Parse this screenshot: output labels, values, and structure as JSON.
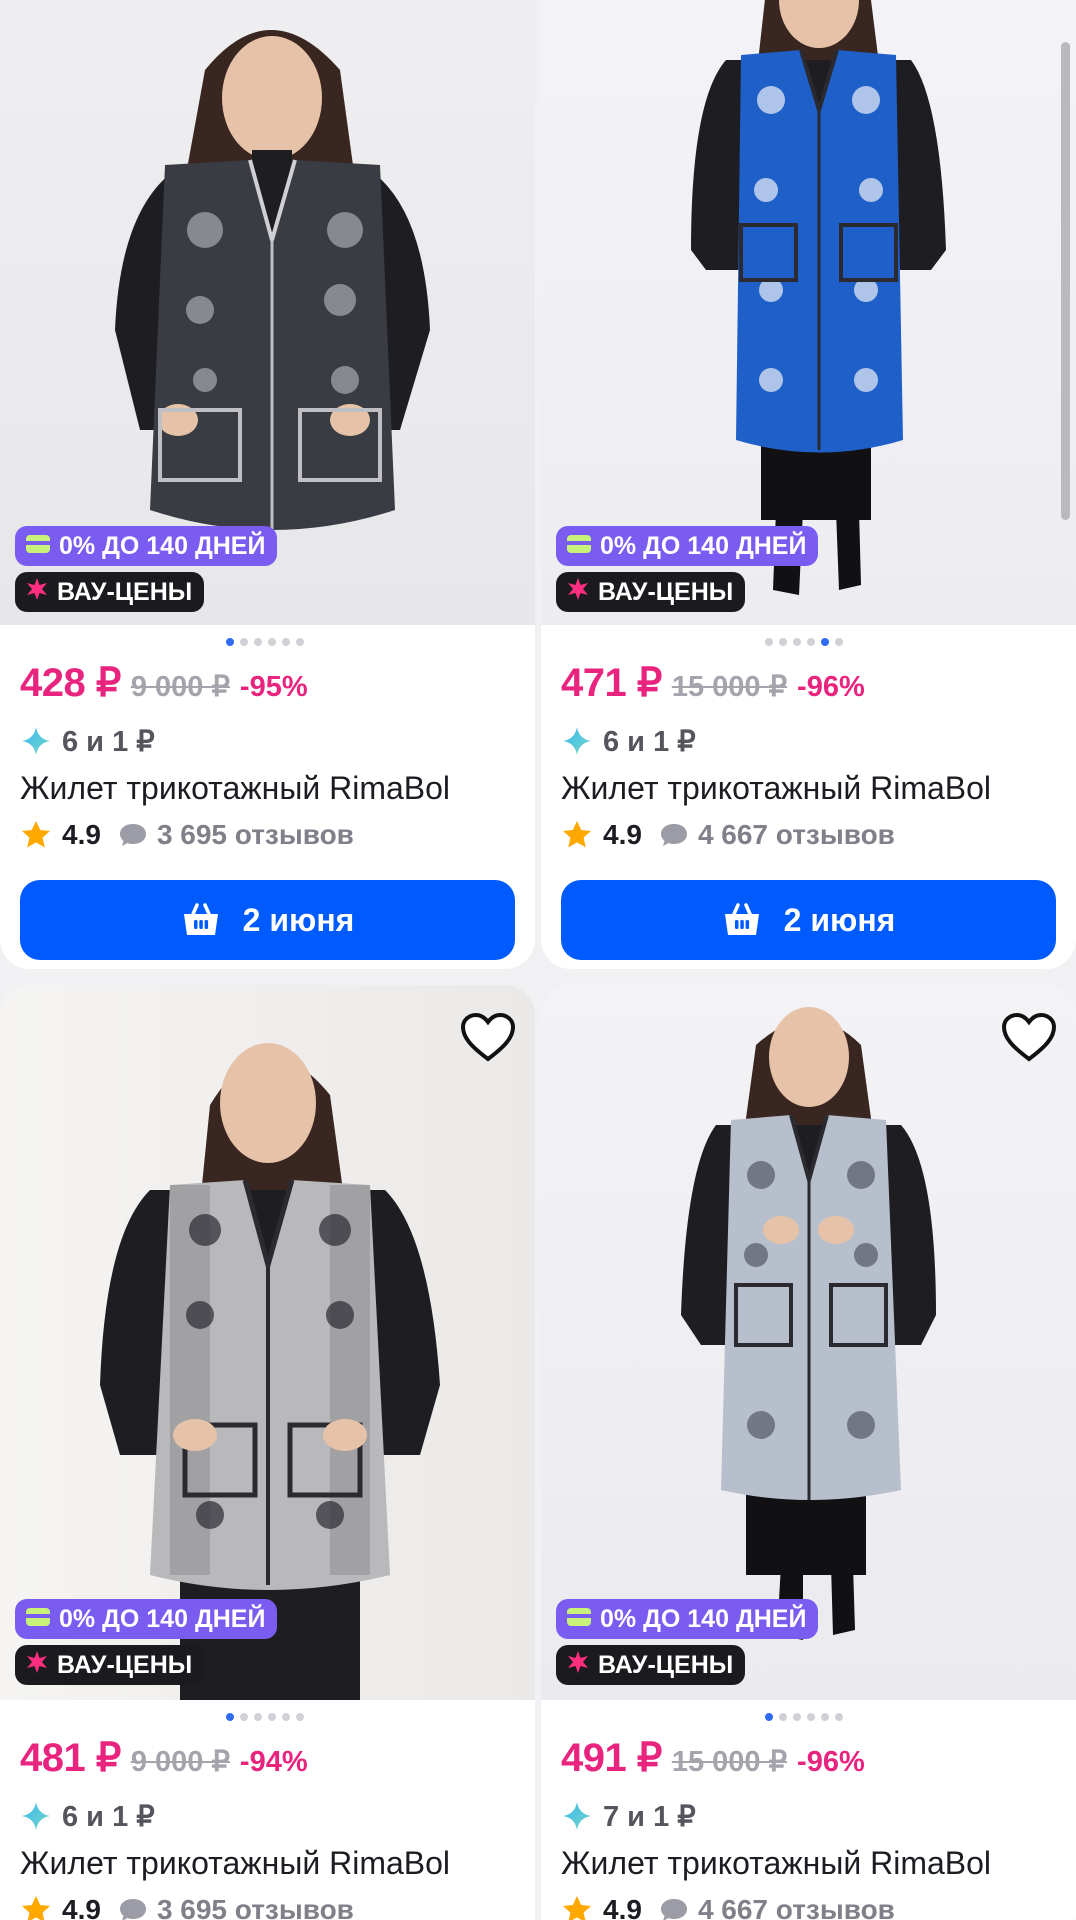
{
  "colors": {
    "price_accent": "#e8247f",
    "button_blue": "#005bff",
    "installment_badge": "#7b5cf0",
    "wow_badge": "#1b1b1f",
    "dot_active": "#2f6bf3"
  },
  "products": [
    {
      "badges": {
        "installment": "0% ДО 140 ДНЕЙ",
        "wow": "ВАУ-ЦЕНЫ"
      },
      "price": "428 ₽",
      "old_price": "9 000 ₽",
      "discount": "-95%",
      "points": "6 и 1 ₽",
      "title": "Жилет трикотажный RimaBol",
      "rating": "4.9",
      "reviews": "3 695 отзывов",
      "cart_label": "2 июня",
      "vest_color": "#3a3c44",
      "image_dots": 6,
      "active_dot": 1
    },
    {
      "badges": {
        "installment": "0% ДО 140 ДНЕЙ",
        "wow": "ВАУ-ЦЕНЫ"
      },
      "price": "471 ₽",
      "old_price": "15 000 ₽",
      "discount": "-96%",
      "points": "6 и 1 ₽",
      "title": "Жилет трикотажный RimaBol",
      "rating": "4.9",
      "reviews": "4 667 отзывов",
      "cart_label": "2 июня",
      "vest_color": "#1f5fc8",
      "image_dots": 6,
      "active_dot": 5
    },
    {
      "badges": {
        "installment": "0% ДО 140 ДНЕЙ",
        "wow": "ВАУ-ЦЕНЫ"
      },
      "price": "481 ₽",
      "old_price": "9 000 ₽",
      "discount": "-94%",
      "points": "6 и 1 ₽",
      "title": "Жилет трикотажный RimaBol",
      "rating": "4.9",
      "reviews": "3 695 отзывов",
      "vest_color": "#b9b9bb",
      "image_dots": 6,
      "active_dot": 1
    },
    {
      "badges": {
        "installment": "0% ДО 140 ДНЕЙ",
        "wow": "ВАУ-ЦЕНЫ"
      },
      "price": "491 ₽",
      "old_price": "15 000 ₽",
      "discount": "-96%",
      "points": "7 и 1 ₽",
      "title": "Жилет трикотажный RimaBol",
      "rating": "4.9",
      "reviews": "4 667 отзывов",
      "vest_color": "#b8bfcc",
      "image_dots": 6,
      "active_dot": 1
    }
  ]
}
